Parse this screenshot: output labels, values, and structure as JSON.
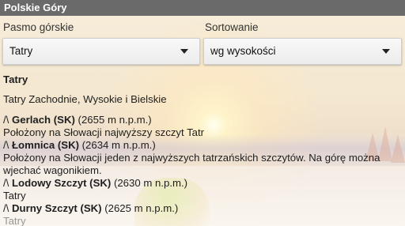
{
  "app": {
    "title": "Polskie Góry"
  },
  "filters": {
    "range_label": "Pasmo górskie",
    "range_value": "Tatry",
    "sort_label": "Sortowanie",
    "sort_value": "wg wysokości"
  },
  "content": {
    "heading": "Tatry",
    "subtitle": "Tatry Zachodnie, Wysokie i Bielskie",
    "peaks": [
      {
        "prefix": "/\\ ",
        "name": "Gerlach (SK)",
        "height": " (2655 m n.p.m.)",
        "desc": "Położony na Słowacji najwyższy szczyt Tatr"
      },
      {
        "prefix": "/\\ ",
        "name": "Łomnica (SK)",
        "height": " (2634 m n.p.m.)",
        "desc": "Położony na Słowacji jeden z najwyższych tatrzańskich szczytów. Na górę można wjechać wagonikiem."
      },
      {
        "prefix": "/\\ ",
        "name": "Lodowy Szczyt (SK)",
        "height": " (2630 m n.p.m.)",
        "desc": "Tatry"
      },
      {
        "prefix": "/\\ ",
        "name": "Durny Szczyt (SK)",
        "height": " (2625 m n.p.m.)",
        "desc": "Tatry"
      }
    ]
  },
  "colors": {
    "titlebar": "#6a6a6a",
    "text": "#1e1e1e"
  }
}
